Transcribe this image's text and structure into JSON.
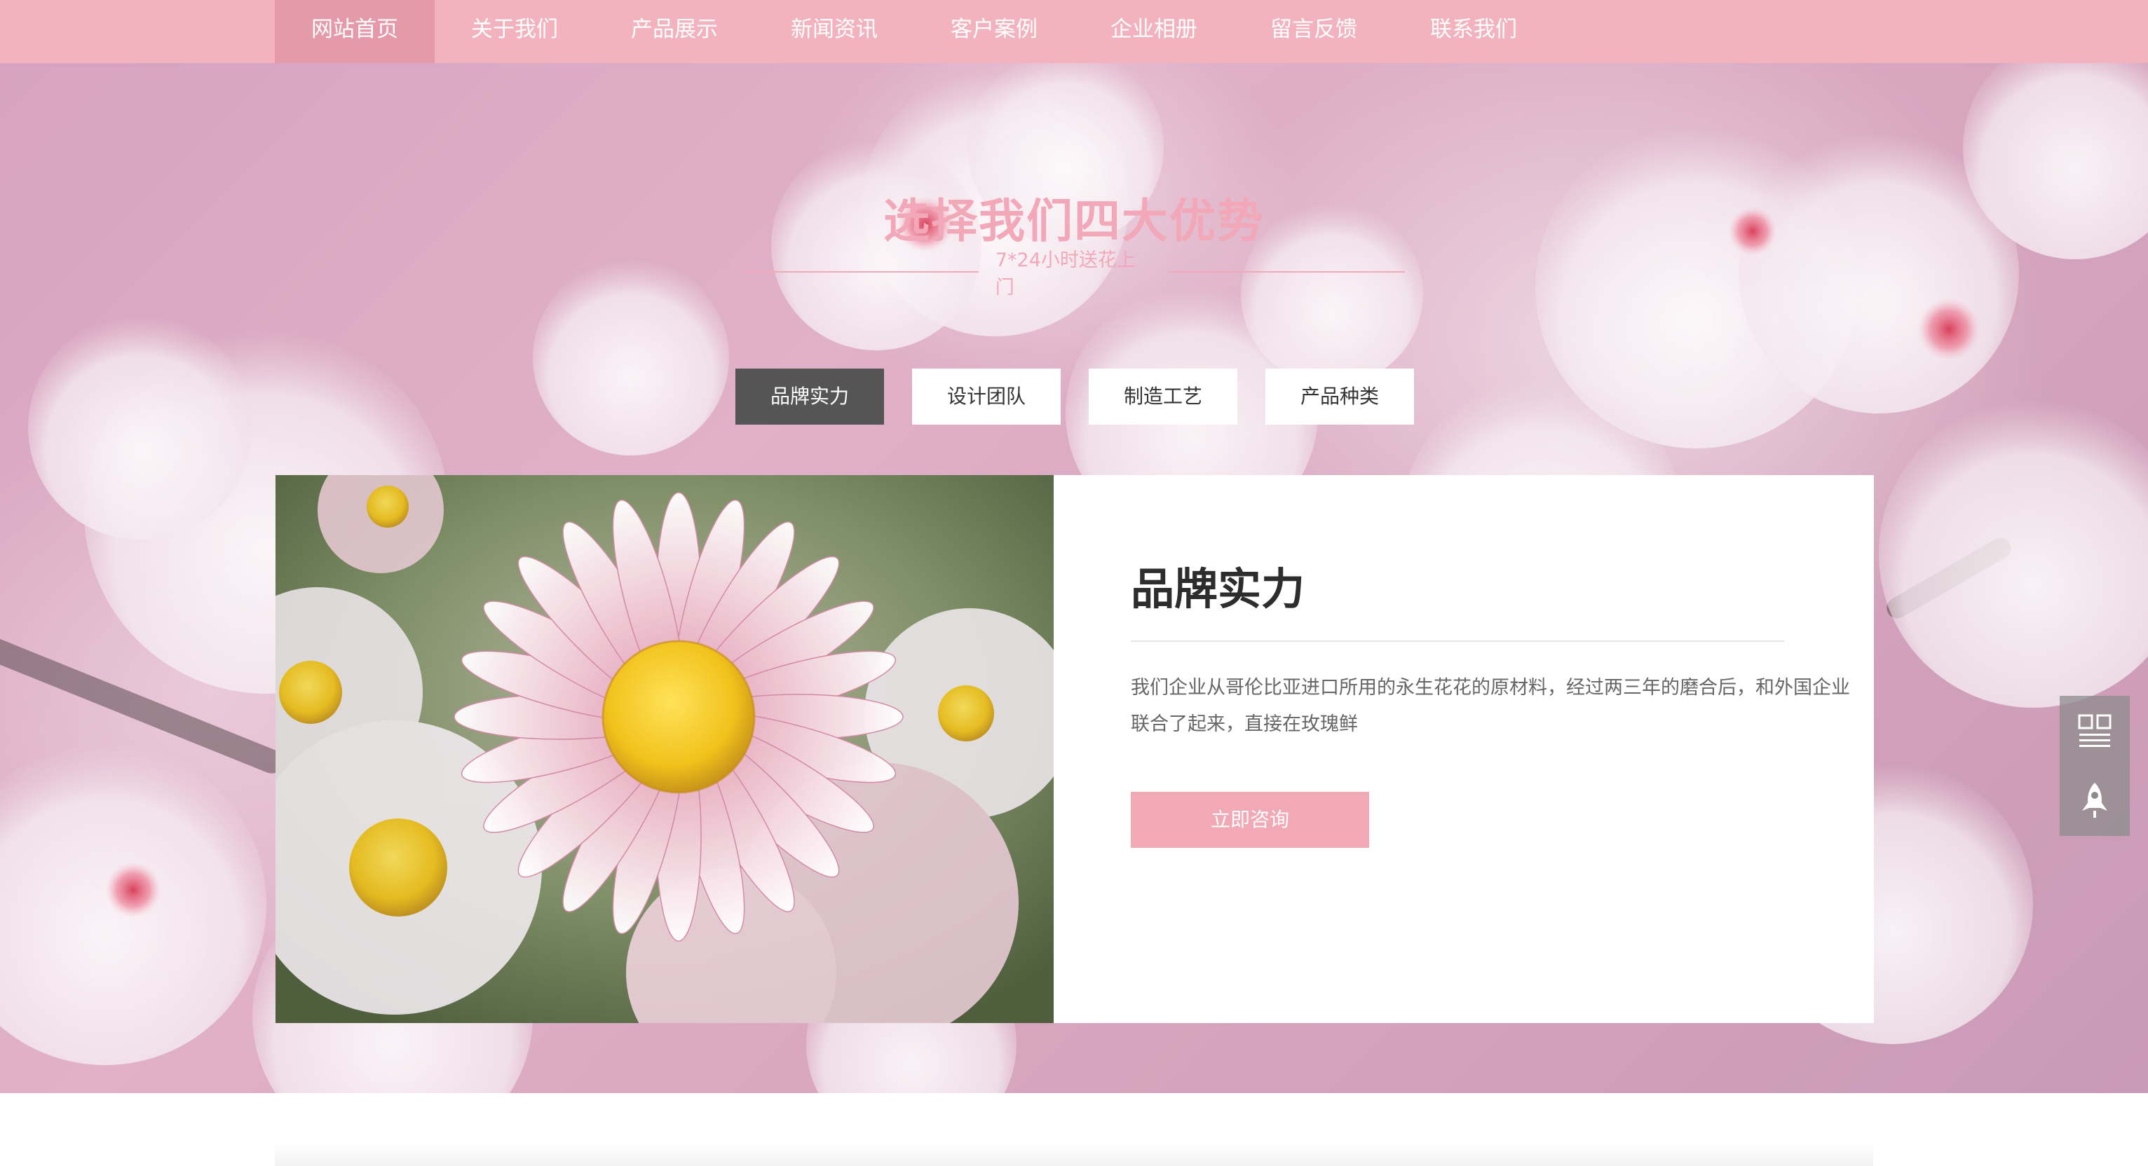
{
  "nav": {
    "items": [
      {
        "label": "网站首页",
        "active": true
      },
      {
        "label": "关于我们",
        "active": false
      },
      {
        "label": "产品展示",
        "active": false
      },
      {
        "label": "新闻资讯",
        "active": false
      },
      {
        "label": "客户案例",
        "active": false
      },
      {
        "label": "企业相册",
        "active": false
      },
      {
        "label": "留言反馈",
        "active": false
      },
      {
        "label": "联系我们",
        "active": false
      }
    ]
  },
  "advantages": {
    "title": "选择我们四大优势",
    "subtitle": "7*24小时送花上门",
    "tabs": [
      {
        "label": "品牌实力",
        "active": true
      },
      {
        "label": "设计团队",
        "active": false
      },
      {
        "label": "制造工艺",
        "active": false
      },
      {
        "label": "产品种类",
        "active": false
      }
    ]
  },
  "content": {
    "heading": "品牌实力",
    "body": "我们企业从哥伦比亚进口所用的永生花花的原材料，经过两三年的磨合后，和外国企业联合了起来，直接在玫瑰鲜",
    "cta_label": "立即咨询",
    "image_icon": "daisy-photo"
  },
  "side_widget": {
    "icons": [
      "qr-code-icon",
      "rocket-icon"
    ]
  },
  "colors": {
    "nav_bg": "#f2b3bf",
    "nav_active": "#e49aa8",
    "accent_pink": "#f2a8b8",
    "button_pink": "#f0a9b5",
    "tab_active": "#555555"
  }
}
